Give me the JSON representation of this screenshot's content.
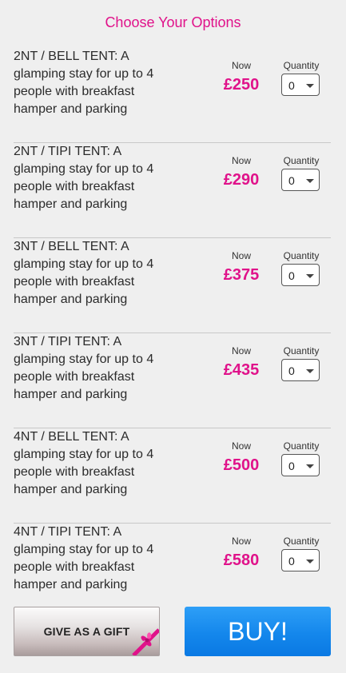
{
  "header": {
    "title": "Choose Your Options"
  },
  "options": [
    {
      "description": "2NT / BELL TENT: A glamping stay for up to 4 people with breakfast hamper and parking",
      "now_label": "Now",
      "price": "£250",
      "quantity_label": "Quantity",
      "quantity": "0"
    },
    {
      "description": "2NT / TIPI TENT: A glamping stay for up to 4 people with breakfast hamper and parking",
      "now_label": "Now",
      "price": "£290",
      "quantity_label": "Quantity",
      "quantity": "0"
    },
    {
      "description": "3NT / BELL TENT: A glamping stay for up to 4 people with breakfast hamper and parking",
      "now_label": "Now",
      "price": "£375",
      "quantity_label": "Quantity",
      "quantity": "0"
    },
    {
      "description": "3NT / TIPI TENT: A glamping stay for up to 4 people with breakfast hamper and parking",
      "now_label": "Now",
      "price": "£435",
      "quantity_label": "Quantity",
      "quantity": "0"
    },
    {
      "description": "4NT / BELL TENT: A glamping stay for up to 4 people with breakfast hamper and parking",
      "now_label": "Now",
      "price": "£500",
      "quantity_label": "Quantity",
      "quantity": "0"
    },
    {
      "description": "4NT / TIPI TENT: A glamping stay for up to 4 people with breakfast hamper and parking",
      "now_label": "Now",
      "price": "£580",
      "quantity_label": "Quantity",
      "quantity": "0"
    }
  ],
  "actions": {
    "gift_label": "GIVE AS A GIFT",
    "gift_icon": "gift-ribbon-icon",
    "buy_label": "BUY!"
  },
  "colors": {
    "accent": "#e0128a",
    "buy_button": "#1487ec",
    "background": "#efefef"
  }
}
